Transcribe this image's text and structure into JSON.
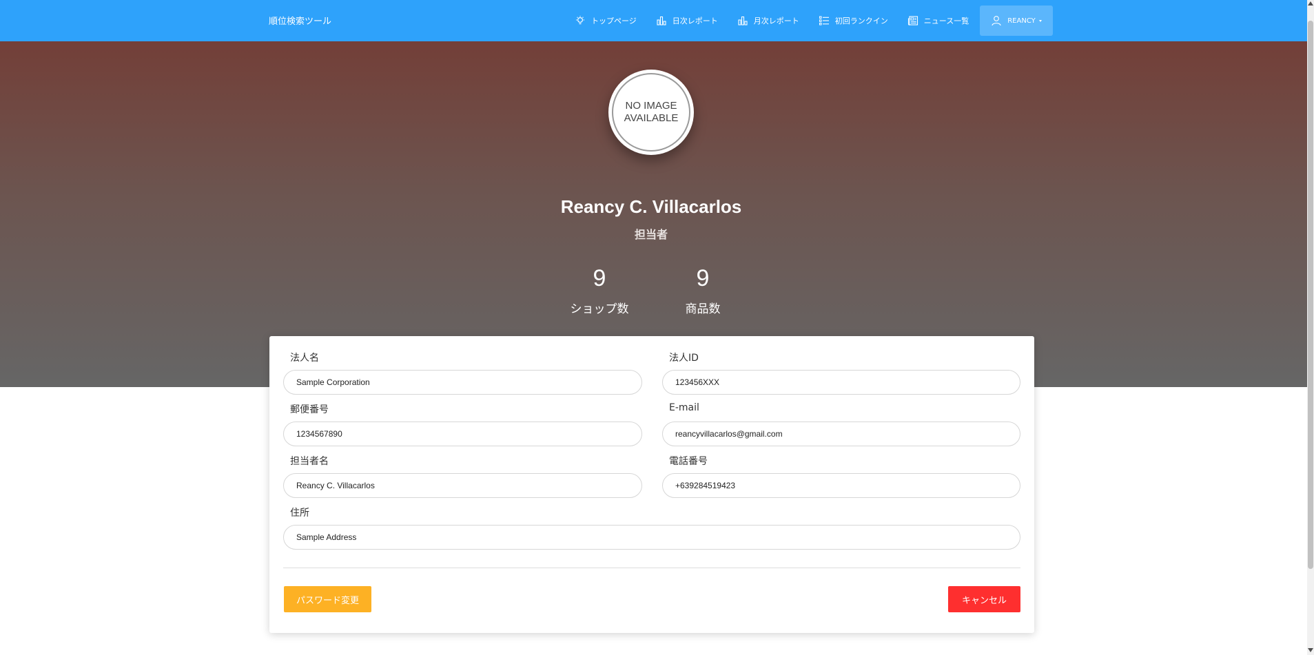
{
  "navbar": {
    "brand": "順位検索ツール",
    "items": [
      {
        "label": "トップページ",
        "icon": "lightbulb-icon"
      },
      {
        "label": "日次レポート",
        "icon": "bar-chart-icon"
      },
      {
        "label": "月次レポート",
        "icon": "bar-chart-icon"
      },
      {
        "label": "初回ランクイン",
        "icon": "list-icon"
      },
      {
        "label": "ニュース一覧",
        "icon": "newspaper-icon"
      }
    ],
    "user": {
      "label": "REANCY",
      "icon": "user-icon"
    },
    "background_color": "#2ea2fb"
  },
  "profile": {
    "avatar_placeholder_line1": "NO IMAGE",
    "avatar_placeholder_line2": "AVAILABLE",
    "name": "Reancy C. Villacarlos",
    "role": "担当者",
    "stats": [
      {
        "value": "9",
        "label": "ショップ数"
      },
      {
        "value": "9",
        "label": "商品数"
      }
    ]
  },
  "form": {
    "company_name": {
      "label": "法人名",
      "value": "Sample Corporation"
    },
    "company_id": {
      "label": "法人ID",
      "value": "123456XXX"
    },
    "postal_code": {
      "label": "郵便番号",
      "value": "1234567890"
    },
    "email": {
      "label": "E-mail",
      "value": "reancyvillacarlos@gmail.com"
    },
    "contact_name": {
      "label": "担当者名",
      "value": "Reancy C. Villacarlos"
    },
    "phone": {
      "label": "電話番号",
      "value": "+639284519423"
    },
    "address": {
      "label": "住所",
      "value": "Sample Address"
    }
  },
  "actions": {
    "change_password": "パスワード変更",
    "cancel": "キャンセル"
  },
  "colors": {
    "primary": "#2ea2fb",
    "warning": "#fdb124",
    "danger": "#fe2f2f"
  }
}
